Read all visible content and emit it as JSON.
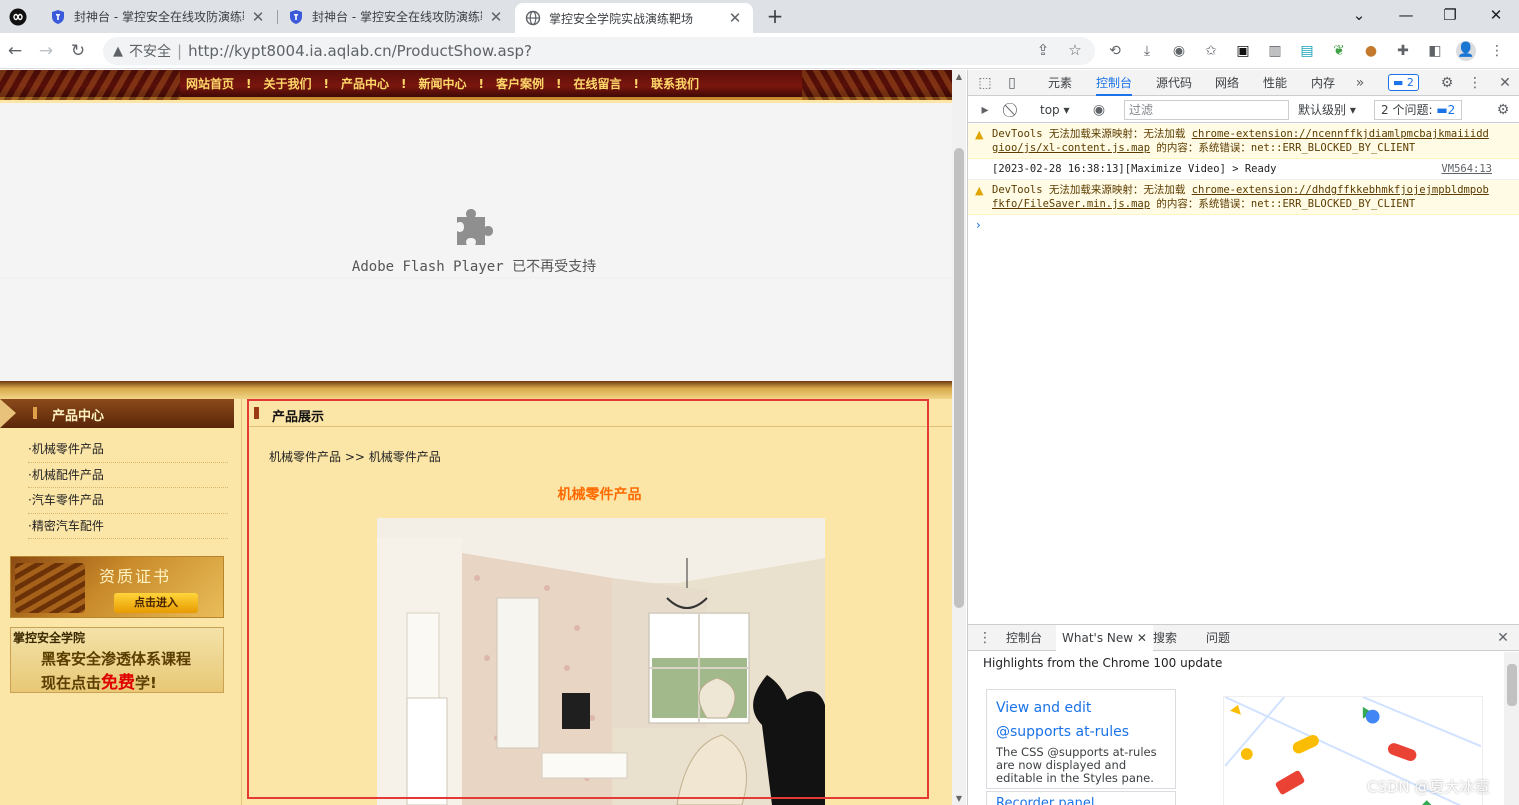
{
  "browser": {
    "tabs": [
      {
        "title": "封神台 - 掌控安全在线攻防演练靶场"
      },
      {
        "title": "封神台 - 掌控安全在线攻防演练靶场"
      },
      {
        "title": "掌控安全学院实战演练靶场"
      }
    ],
    "address": {
      "security_label": "不安全",
      "url": "http://kypt8004.ia.aqlab.cn/ProductShow.asp?"
    }
  },
  "site": {
    "nav": [
      "网站首页",
      "关于我们",
      "产品中心",
      "新闻中心",
      "客户案例",
      "在线留言",
      "联系我们"
    ],
    "nav_separator": "!",
    "flash_message": "Adobe Flash Player 已不再受支持",
    "sidebar": {
      "title": "产品中心",
      "items": [
        "·机械零件产品",
        "·机械配件产品",
        "·汽车零件产品",
        "·精密汽车配件"
      ],
      "cert_title": "资质证书",
      "cert_button": "点击进入",
      "ad_line1": "掌控安全学院",
      "ad_line2": "黑客安全渗透体系课程",
      "ad_line3_pre": "现在点击",
      "ad_line3_free": "免费",
      "ad_line3_post": "学!"
    },
    "main": {
      "title": "产品展示",
      "breadcrumb": "机械零件产品 >> 机械零件产品",
      "product_title": "机械零件产品"
    }
  },
  "devtools": {
    "tabs": [
      "元素",
      "控制台",
      "源代码",
      "网络",
      "性能",
      "内存"
    ],
    "active_tab": "控制台",
    "badge_count": "2",
    "context": "top",
    "filter_placeholder": "过滤",
    "level": "默认级别",
    "issues": "2 个问题:",
    "issues_count": "2",
    "messages": [
      {
        "pre": "DevTools 无法加载来源映射：无法加载 ",
        "link": "chrome-extension://ncennffkjdiamlpmcbajkmaiiiddgioo/js/xl-content.js.map",
        "post": " 的内容：系统错误：net::ERR_BLOCKED_BY_CLIENT"
      },
      {
        "text": "[2023-02-28 16:38:13][Maximize Video] > Ready",
        "source": "VM564:13"
      },
      {
        "pre": "DevTools 无法加载来源映射：无法加载 ",
        "link": "chrome-extension://dhdgffkkebhmkfjojejmpbldmpobfkfo/FileSaver.min.js.map",
        "post": " 的内容：系统错误：net::ERR_BLOCKED_BY_CLIENT"
      }
    ],
    "drawer": {
      "tabs": [
        "控制台",
        "What's New",
        "搜索",
        "问题"
      ],
      "active": "What's New",
      "headline": "Highlights from the Chrome 100 update",
      "card_title": "View and edit @supports at-rules",
      "card_desc": "The CSS @supports at-rules are now displayed and editable in the Styles pane.",
      "card2_title": "Recorder panel"
    }
  },
  "watermark": "CSDN @夏大冰雹"
}
